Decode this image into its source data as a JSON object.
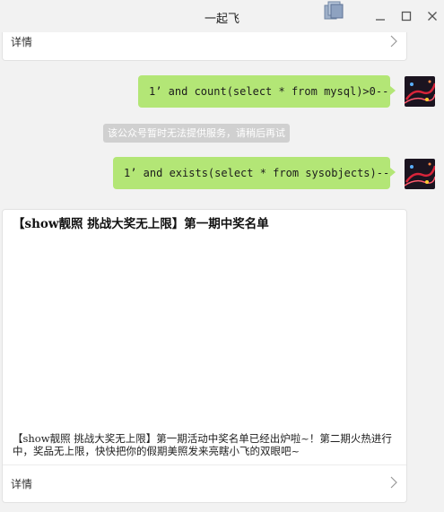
{
  "window": {
    "title": "一起飞",
    "icons": {
      "multiwindow": "multi-window-icon",
      "minimize": "minimize-icon",
      "maximize": "maximize-icon",
      "close": "close-icon"
    }
  },
  "top_card": {
    "detail_label": "详情"
  },
  "messages": [
    {
      "text": "1’ and count(select * from mysql)>0--"
    },
    {
      "text": "1’ and exists(select * from sysobjects)--"
    }
  ],
  "system_notice": "该公众号暂时无法提供服务，请稍后再试",
  "article": {
    "title": "【show靓照 挑战大奖无上限】第一期中奖名单",
    "summary": "【show靓照 挑战大奖无上限】第一期活动中奖名单已经出炉啦~！第二期火热进行中，奖品无上限，快快把你的假期美照发来亮瞎小飞的双眼吧~",
    "detail_label": "详情"
  },
  "colors": {
    "background": "#f2f2f2",
    "bubble": "#b3e676",
    "notice_bg": "#d0d0d0",
    "card_bg": "#ffffff"
  }
}
